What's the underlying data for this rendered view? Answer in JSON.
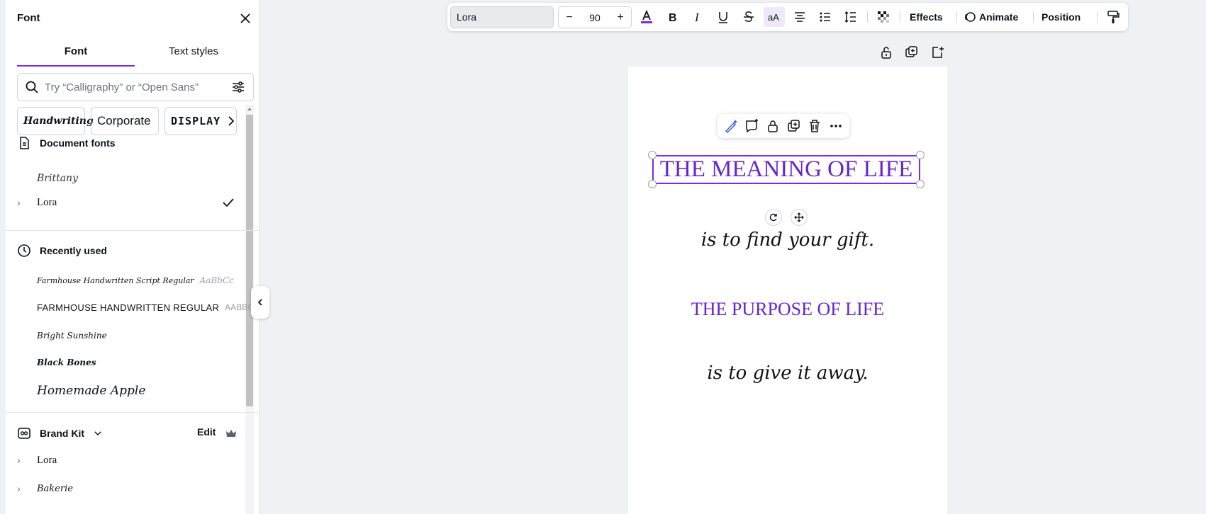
{
  "panel": {
    "title": "Font",
    "tabs": [
      {
        "label": "Font",
        "active": true
      },
      {
        "label": "Text styles",
        "active": false
      }
    ],
    "search": {
      "placeholder": "Try “Calligraphy” or “Open Sans”",
      "value": ""
    },
    "chips": [
      "Handwriting",
      "Corporate",
      "DISPLAY"
    ],
    "document_fonts": {
      "title": "Document fonts",
      "items": [
        {
          "name": "Brittany"
        },
        {
          "name": "Lora",
          "selected": true
        }
      ]
    },
    "recently_used": {
      "title": "Recently used",
      "items": [
        {
          "name": "Farmhouse Handwritten Script Regular",
          "sample": "AaBbCc"
        },
        {
          "name": "FARMHOUSE HANDWRITTEN REGULAR",
          "sample": "AABBCC"
        },
        {
          "name": "Bright Sunshine"
        },
        {
          "name": "Black Bones"
        },
        {
          "name": "Homemade Apple"
        }
      ]
    },
    "brand_kit": {
      "title": "Brand Kit",
      "edit_label": "Edit",
      "items": [
        {
          "name": "Lora"
        },
        {
          "name": "Bakerie"
        }
      ]
    }
  },
  "toolbar": {
    "font_name": "Lora",
    "font_size": "90",
    "decrease": "−",
    "increase": "+",
    "effects_label": "Effects",
    "animate_label": "Animate",
    "position_label": "Position"
  },
  "canvas": {
    "title": "THE MEANING OF LIFE",
    "line2": "is to find your gift.",
    "heading2": "THE PURPOSE OF LIFE",
    "line4": "is to give it away."
  },
  "colors": {
    "accent": "#7d2ae8",
    "title_text": "#6425d0"
  }
}
